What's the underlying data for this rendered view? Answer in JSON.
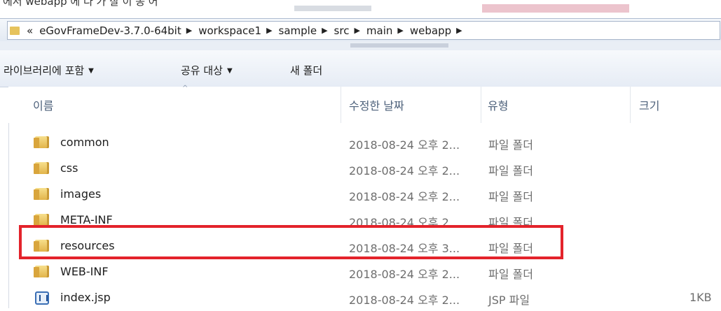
{
  "window": {
    "top_caption": "에서 webapp 에 다 가 잘 이 동 어"
  },
  "address_bar": {
    "overflow_chevron": "«",
    "crumbs": [
      "eGovFrameDev-3.7.0-64bit",
      "workspace1",
      "sample",
      "src",
      "main",
      "webapp"
    ],
    "separator": "▶"
  },
  "toolbar": {
    "include_library": "라이브러리에 포함",
    "share_with": "공유 대상",
    "new_folder": "새 폴더",
    "dropdown_glyph": "▼"
  },
  "columns": {
    "name": "이름",
    "modified": "수정한 날짜",
    "type": "유형",
    "size": "크기",
    "sort_glyph": "^"
  },
  "files": [
    {
      "name": "common",
      "modified": "2018-08-24 오후 2...",
      "type": "파일 폴더",
      "size": "",
      "icon": "folder-icon"
    },
    {
      "name": "css",
      "modified": "2018-08-24 오후 2...",
      "type": "파일 폴더",
      "size": "",
      "icon": "folder-icon"
    },
    {
      "name": "images",
      "modified": "2018-08-24 오후 2...",
      "type": "파일 폴더",
      "size": "",
      "icon": "folder-icon"
    },
    {
      "name": "META-INF",
      "modified": "2018-08-24 오후 2...",
      "type": "파일 폴더",
      "size": "",
      "icon": "folder-icon"
    },
    {
      "name": "resources",
      "modified": "2018-08-24 오후 3...",
      "type": "파일 폴더",
      "size": "",
      "icon": "folder-icon"
    },
    {
      "name": "WEB-INF",
      "modified": "2018-08-24 오후 2...",
      "type": "파일 폴더",
      "size": "",
      "icon": "folder-icon"
    },
    {
      "name": "index.jsp",
      "modified": "2018-08-24 오후 2...",
      "type": "JSP 파일",
      "size": "1KB",
      "icon": "jsp-file-icon"
    }
  ],
  "colors": {
    "highlight": "#e3232b",
    "header_text": "#4c607a",
    "folder": "#e2b44a"
  }
}
